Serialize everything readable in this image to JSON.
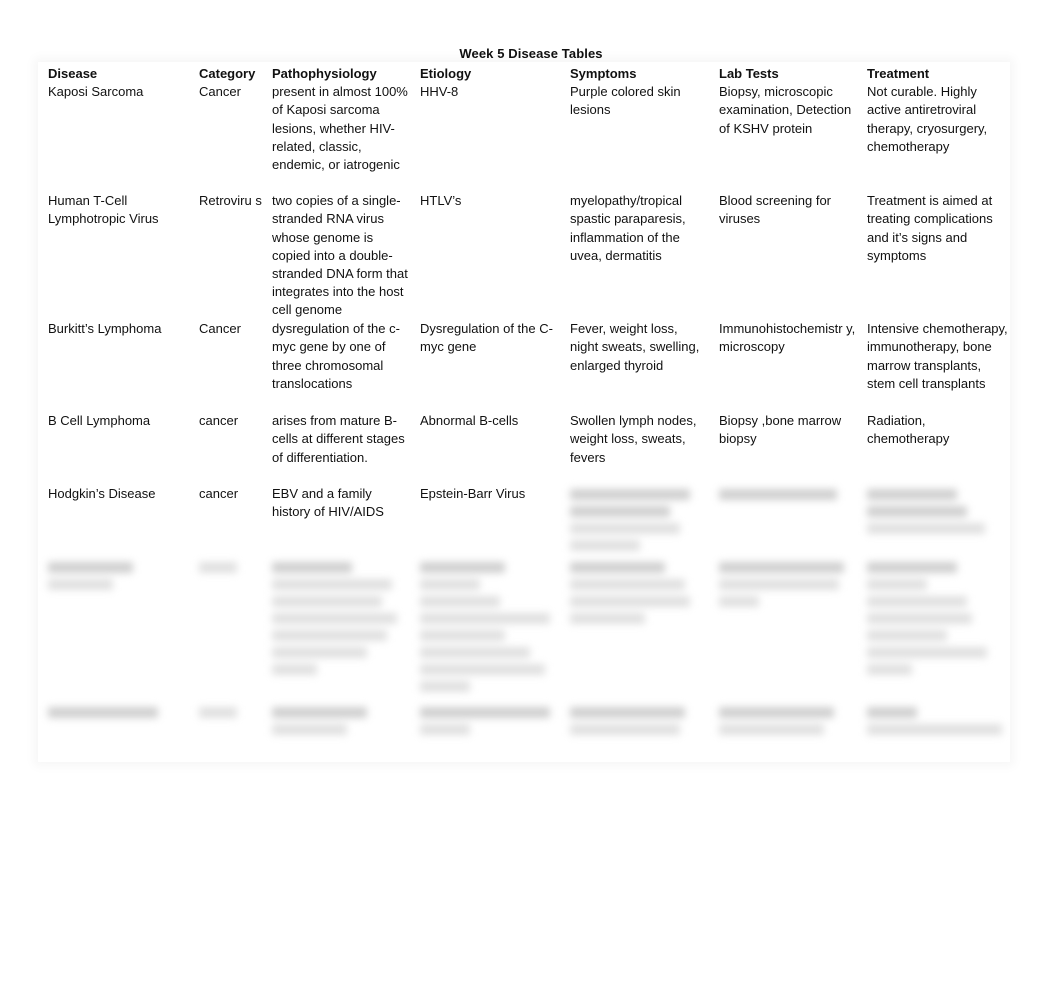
{
  "document": {
    "title": "Week 5 Disease Tables",
    "headers": [
      "Disease",
      "Category",
      "Pathophysiology",
      "Etiology",
      "Symptoms",
      "Lab Tests",
      "Treatment"
    ],
    "rows": [
      {
        "disease": "Kaposi Sarcoma",
        "category": "Cancer",
        "pathophysiology": " present in almost 100% of Kaposi sarcoma lesions, whether HIV-related, classic, endemic, or iatrogenic",
        "etiology": "HHV-8",
        "symptoms": "Purple colored skin lesions",
        "lab_tests": "Biopsy, microscopic examination, Detection of KSHV protein",
        "treatment": "Not curable. Highly active antiretroviral therapy, cryosurgery, chemotherapy"
      },
      {
        "disease": "Human T-Cell Lymphotropic Virus",
        "category": "Retroviru s",
        "pathophysiology": "two copies of a single-stranded RNA virus whose genome is copied into a double-stranded DNA form that integrates into the host cell genome",
        "etiology": "HTLV’s",
        "symptoms": "myelopathy/tropical spastic paraparesis, inflammation of the uvea, dermatitis",
        "lab_tests": "Blood screening for viruses",
        "treatment": "Treatment is aimed at treating complications and it’s signs and symptoms"
      },
      {
        "disease": "Burkitt’s Lymphoma",
        "category": "Cancer",
        "pathophysiology": "dysregulation of the c-myc gene by one of three chromosomal translocations",
        "etiology": "Dysregulation of the C-myc gene",
        "symptoms": "Fever, weight loss, night sweats, swelling, enlarged thyroid",
        "lab_tests": "Immunohistochemistr y, microscopy",
        "treatment": "Intensive chemotherapy, immunotherapy, bone marrow transplants, stem cell transplants"
      },
      {
        "disease": "B Cell Lymphoma",
        "category": "cancer",
        "pathophysiology": "arises from mature B-cells at different stages of differentiation.",
        "etiology": " Abnormal B-cells",
        "symptoms": "Swollen lymph nodes, weight loss, sweats, fevers",
        "lab_tests": "Biopsy ,bone marrow biopsy",
        "treatment": "Radiation, chemotherapy"
      },
      {
        "disease": "Hodgkin’s Disease",
        "category": "cancer",
        "pathophysiology": "EBV and a family history of HIV/AIDS",
        "etiology": "Epstein-Barr Virus",
        "symptoms": "",
        "lab_tests": "",
        "treatment": ""
      }
    ]
  }
}
